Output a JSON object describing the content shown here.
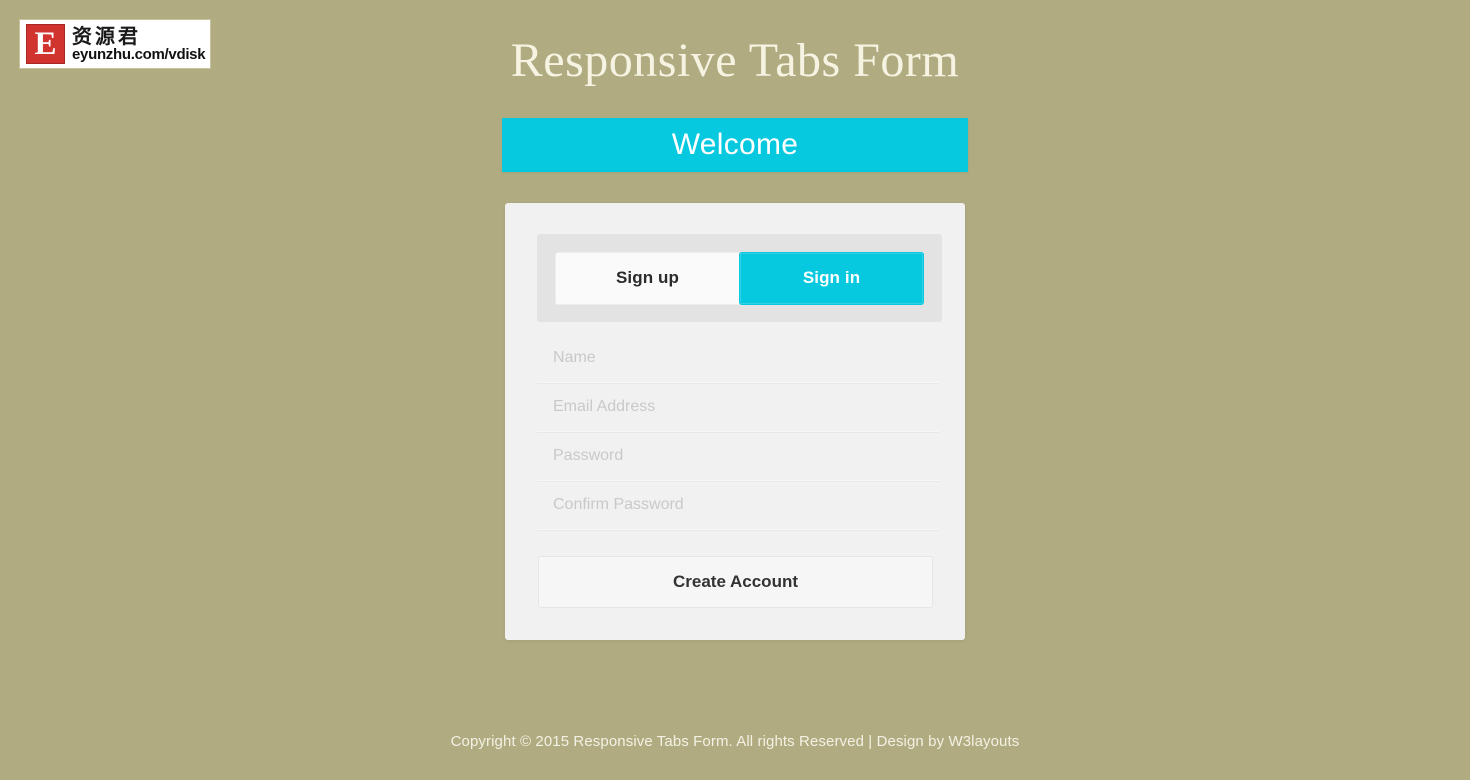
{
  "colors": {
    "page_background": "#b0ab80",
    "accent_cyan": "#06c8de",
    "card_background": "#f1f1f1",
    "tabbar_background": "#e3e3e3",
    "title_text": "#f6f3e2",
    "placeholder_text": "#c9c9c9",
    "logo_red": "#d1342f"
  },
  "logo": {
    "mark_letter": "E",
    "brand_cn": "资源君",
    "brand_url": "eyunzhu.com/vdisk"
  },
  "header": {
    "title": "Responsive Tabs Form"
  },
  "banner": {
    "label": "Welcome"
  },
  "tabs": [
    {
      "id": "signup",
      "label": "Sign up",
      "active": false
    },
    {
      "id": "signin",
      "label": "Sign in",
      "active": true
    }
  ],
  "form": {
    "fields": [
      {
        "id": "name",
        "type": "text",
        "placeholder": "Name",
        "value": ""
      },
      {
        "id": "email",
        "type": "text",
        "placeholder": "Email Address",
        "value": ""
      },
      {
        "id": "password",
        "type": "password",
        "placeholder": "Password",
        "value": ""
      },
      {
        "id": "confirm_password",
        "type": "password",
        "placeholder": "Confirm Password",
        "value": ""
      }
    ],
    "submit_label": "Create Account"
  },
  "footer": {
    "text": "Copyright © 2015 Responsive Tabs Form. All rights Reserved | Design by W3layouts"
  }
}
